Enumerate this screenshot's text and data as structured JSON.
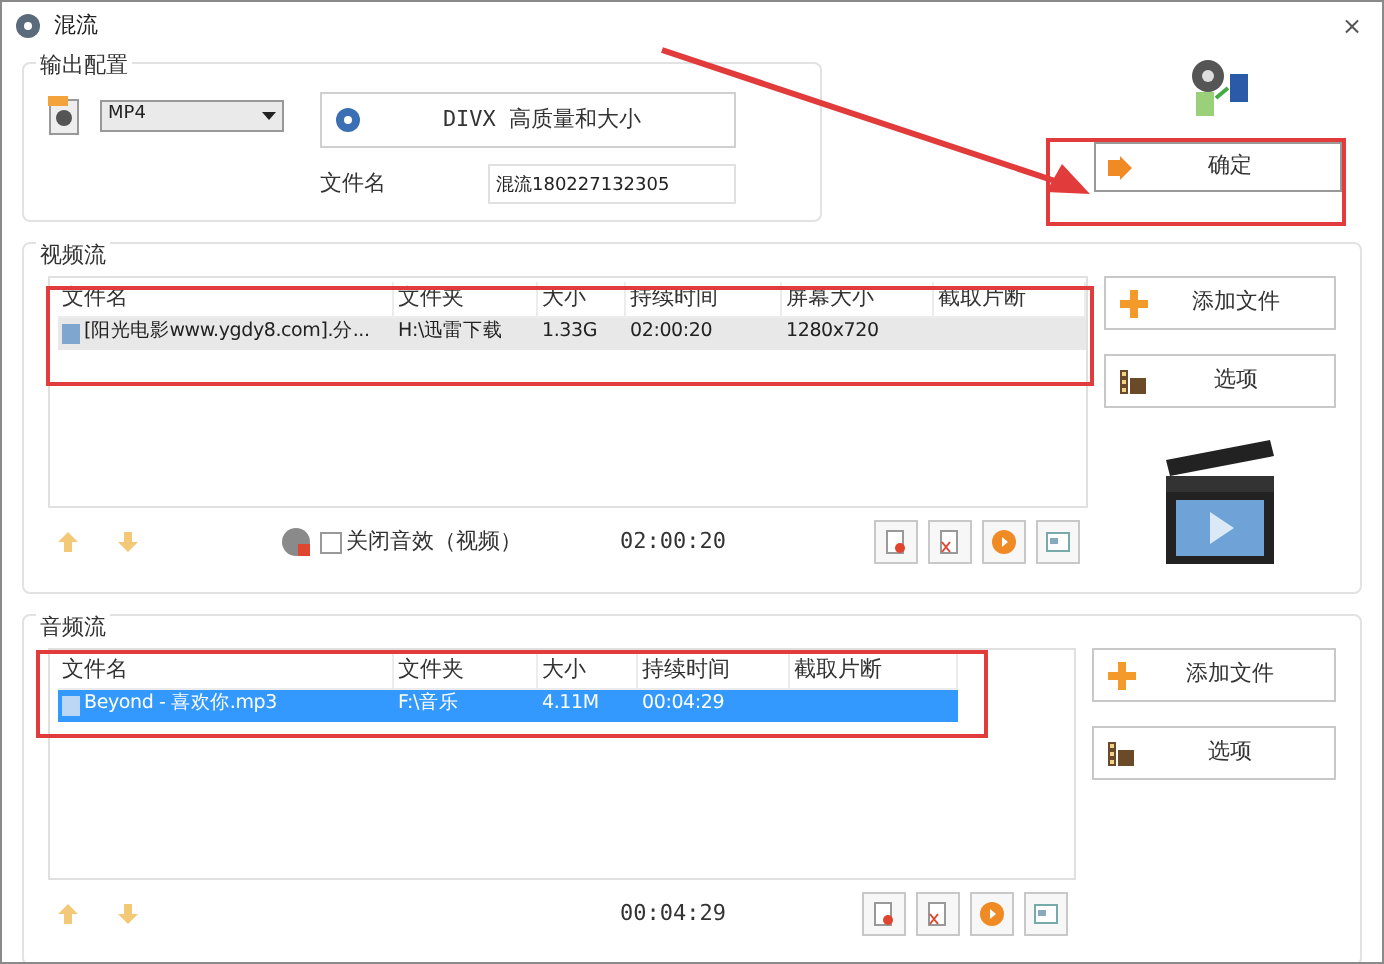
{
  "window": {
    "title": "混流",
    "close": "×"
  },
  "output_config": {
    "title": "输出配置",
    "format": "MP4",
    "preset": "DIVX 高质量和大小",
    "filename_label": "文件名",
    "filename_value": "混流180227132305"
  },
  "confirm_button": "确定",
  "video_stream": {
    "title": "视频流",
    "focused": false,
    "columns": [
      "文件名",
      "文件夹",
      "大小",
      "持续时间",
      "屏幕大小",
      "截取片断"
    ],
    "rows": [
      {
        "cells": [
          "[阳光电影www.ygdy8.com].分...",
          "H:\\迅雷下载",
          "1.33G",
          "02:00:20",
          "1280x720",
          ""
        ],
        "selected": true
      }
    ],
    "mute_checkbox": {
      "label": "关闭音效（视频）",
      "checked": false
    },
    "total_time": "02:00:20",
    "add_button": "添加文件",
    "options_button": "选项"
  },
  "audio_stream": {
    "title": "音频流",
    "focused": true,
    "columns": [
      "文件名",
      "文件夹",
      "大小",
      "持续时间",
      "截取片断"
    ],
    "rows": [
      {
        "cells": [
          "Beyond - 喜欢你.mp3",
          "F:\\音乐",
          "4.11M",
          "00:04:29",
          ""
        ],
        "selected": true
      }
    ],
    "total_time": "00:04:29",
    "add_button": "添加文件",
    "options_button": "选项"
  }
}
